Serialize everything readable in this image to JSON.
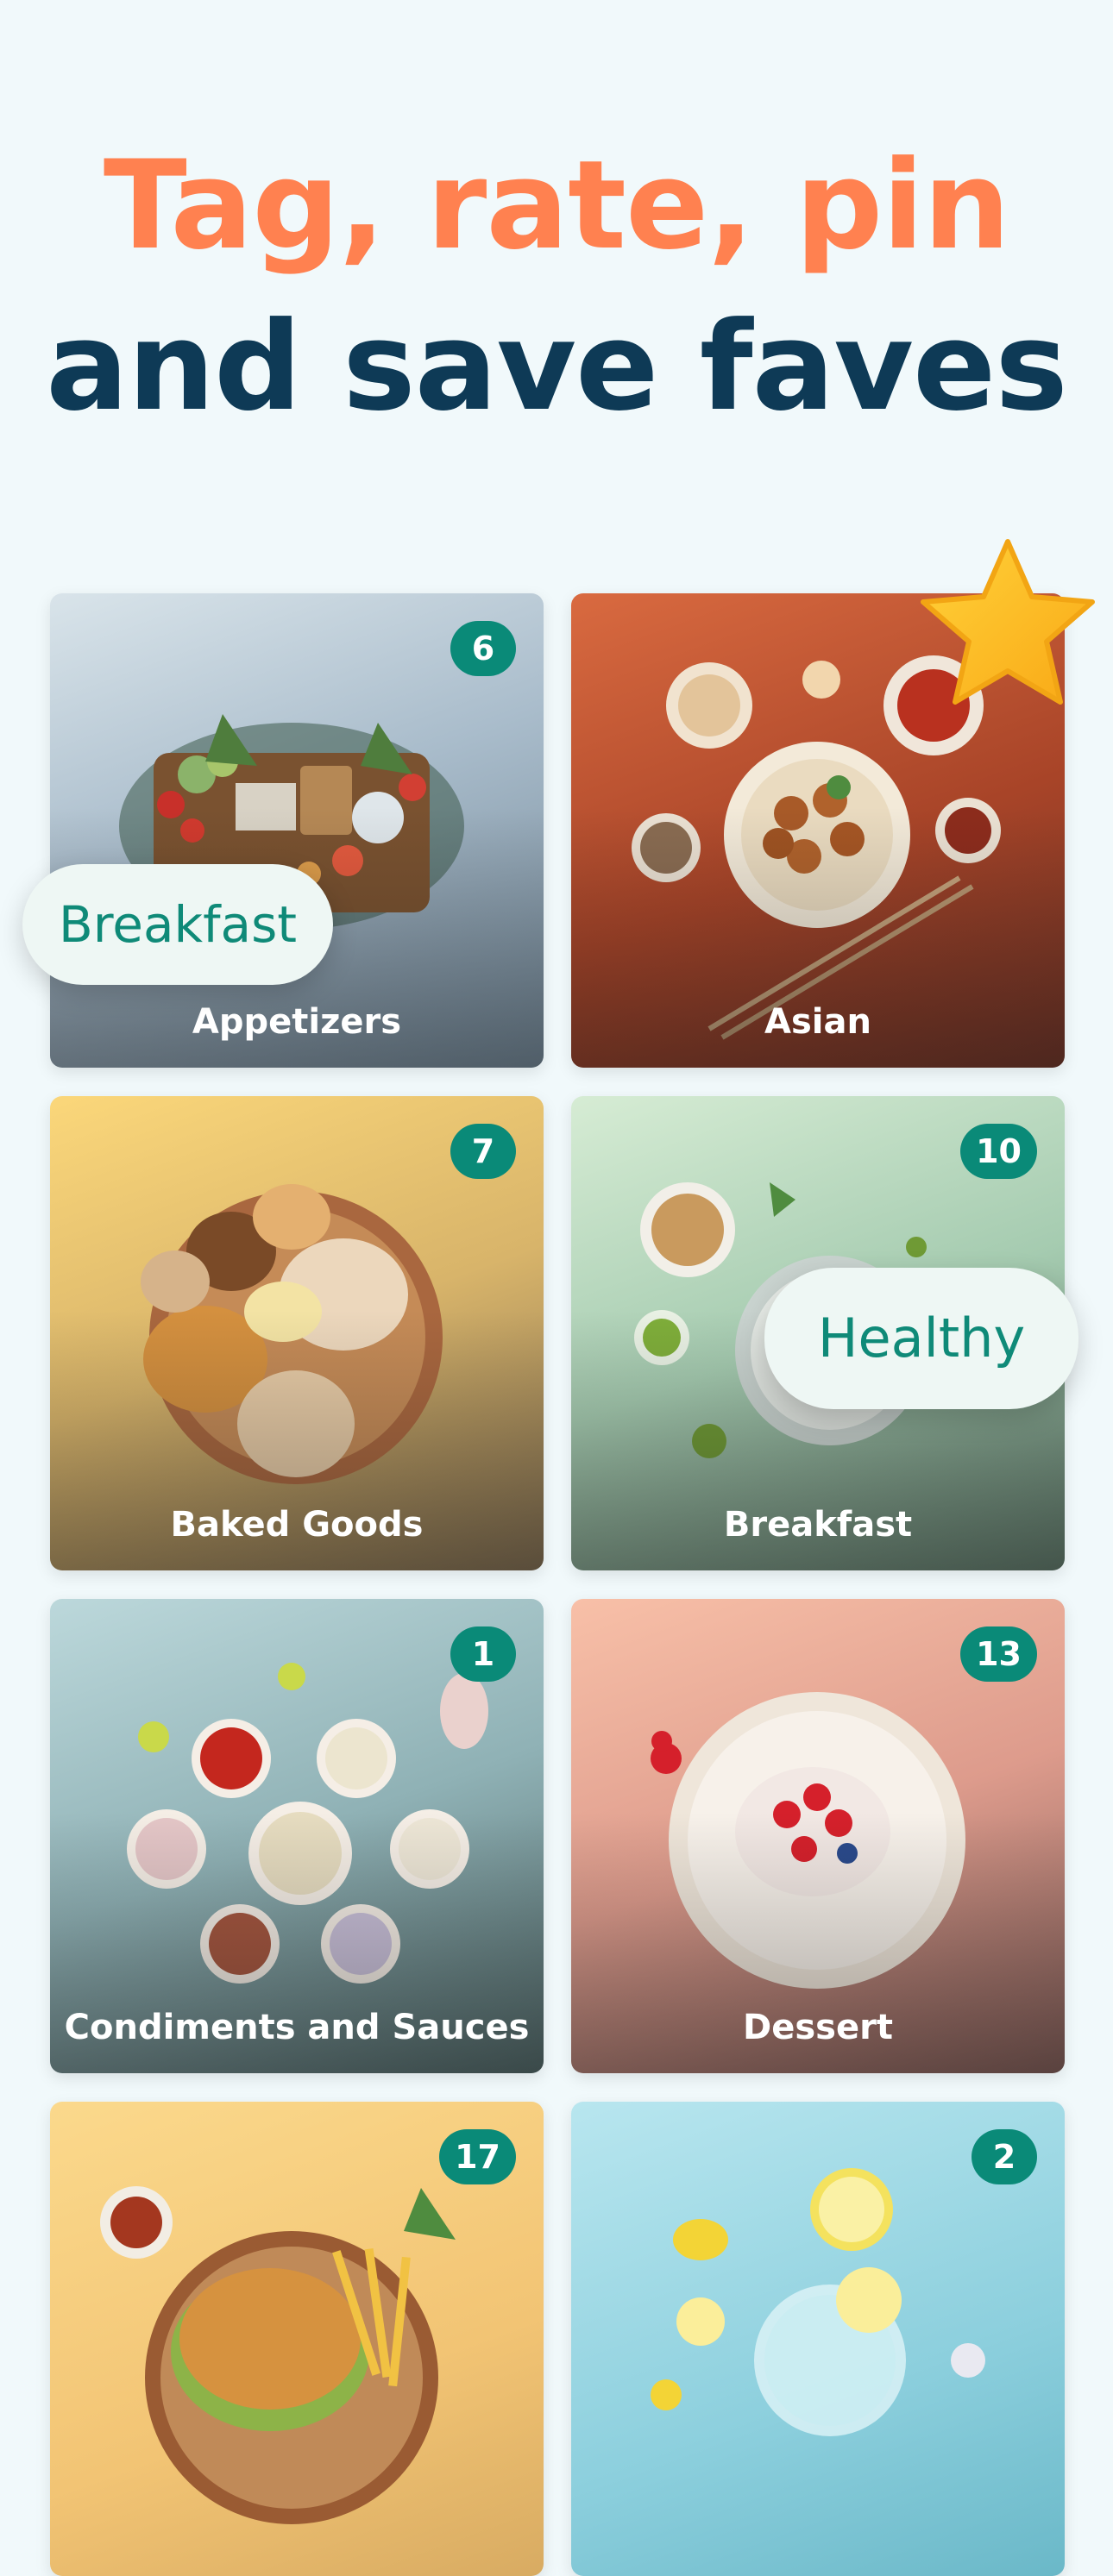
{
  "header": {
    "line1": "Tag, rate, pin",
    "line2": "and save faves"
  },
  "categories": [
    {
      "name": "Appetizers",
      "count": "6"
    },
    {
      "name": "Asian",
      "count": ""
    },
    {
      "name": "Baked Goods",
      "count": "7"
    },
    {
      "name": "Breakfast",
      "count": "10"
    },
    {
      "name": "Condiments and Sauces",
      "count": "1"
    },
    {
      "name": "Dessert",
      "count": "13"
    },
    {
      "name": "",
      "count": "17"
    },
    {
      "name": "",
      "count": "2"
    }
  ],
  "tags": {
    "breakfast": "Breakfast",
    "healthy": "Healthy"
  },
  "colors": {
    "background": "#f1f9fb",
    "accent_orange": "#ff8150",
    "heading_navy": "#0e3a56",
    "badge_green": "#0a8a78",
    "star_gold": "#ffc21a"
  },
  "icons": {
    "favorite": "star-icon"
  }
}
